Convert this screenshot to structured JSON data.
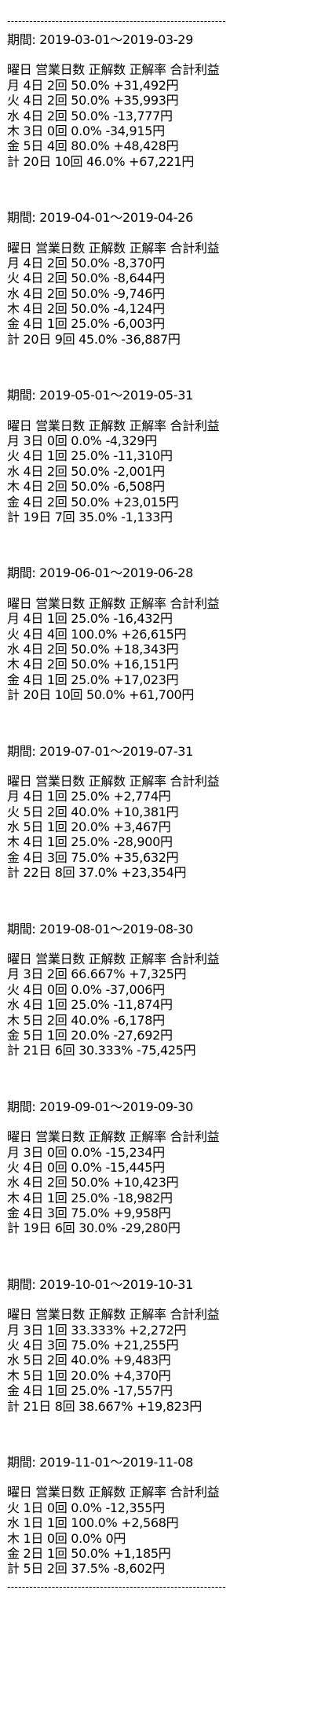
{
  "divider": "-----------------------------------------------------------",
  "period_label": "期間:",
  "header": "曜日 営業日数 正解数 正解率 合計利益",
  "blocks": [
    {
      "period": "2019-03-01〜2019-03-29",
      "rows": [
        "月 4日 2回 50.0% +31,492円",
        "火 4日 2回 50.0% +35,993円",
        "水 4日 2回 50.0% -13,777円",
        "木 3日 0回 0.0% -34,915円",
        "金 5日 4回 80.0% +48,428円",
        "計 20日 10回 46.0% +67,221円"
      ]
    },
    {
      "period": "2019-04-01〜2019-04-26",
      "rows": [
        "月 4日 2回 50.0% -8,370円",
        "火 4日 2回 50.0% -8,644円",
        "水 4日 2回 50.0% -9,746円",
        "木 4日 2回 50.0% -4,124円",
        "金 4日 1回 25.0% -6,003円",
        "計 20日 9回 45.0% -36,887円"
      ]
    },
    {
      "period": "2019-05-01〜2019-05-31",
      "rows": [
        "月 3日 0回 0.0% -4,329円",
        "火 4日 1回 25.0% -11,310円",
        "水 4日 2回 50.0% -2,001円",
        "木 4日 2回 50.0% -6,508円",
        "金 4日 2回 50.0% +23,015円",
        "計 19日 7回 35.0% -1,133円"
      ]
    },
    {
      "period": "2019-06-01〜2019-06-28",
      "rows": [
        "月 4日 1回 25.0% -16,432円",
        "火 4日 4回 100.0% +26,615円",
        "水 4日 2回 50.0% +18,343円",
        "木 4日 2回 50.0% +16,151円",
        "金 4日 1回 25.0% +17,023円",
        "計 20日 10回 50.0% +61,700円"
      ]
    },
    {
      "period": "2019-07-01〜2019-07-31",
      "rows": [
        "月 4日 1回 25.0% +2,774円",
        "火 5日 2回 40.0% +10,381円",
        "水 5日 1回 20.0% +3,467円",
        "木 4日 1回 25.0% -28,900円",
        "金 4日 3回 75.0% +35,632円",
        "計 22日 8回 37.0% +23,354円"
      ]
    },
    {
      "period": "2019-08-01〜2019-08-30",
      "rows": [
        "月 3日 2回 66.667% +7,325円",
        "火 4日 0回 0.0% -37,006円",
        "水 4日 1回 25.0% -11,874円",
        "木 5日 2回 40.0% -6,178円",
        "金 5日 1回 20.0% -27,692円",
        "計 21日 6回 30.333% -75,425円"
      ]
    },
    {
      "period": "2019-09-01〜2019-09-30",
      "rows": [
        "月 3日 0回 0.0% -15,234円",
        "火 4日 0回 0.0% -15,445円",
        "水 4日 2回 50.0% +10,423円",
        "木 4日 1回 25.0% -18,982円",
        "金 4日 3回 75.0% +9,958円",
        "計 19日 6回 30.0% -29,280円"
      ]
    },
    {
      "period": "2019-10-01〜2019-10-31",
      "rows": [
        "月 3日 1回 33.333% +2,272円",
        "火 4日 3回 75.0% +21,255円",
        "水 5日 2回 40.0% +9,483円",
        "木 5日 1回 20.0% +4,370円",
        "金 4日 1回 25.0% -17,557円",
        "計 21日 8回 38.667% +19,823円"
      ]
    },
    {
      "period": "2019-11-01〜2019-11-08",
      "rows": [
        "火 1日 0回 0.0% -12,355円",
        "水 1日 1回 100.0% +2,568円",
        "木 1日 0回 0.0% 0円",
        "金 2日 1回 50.0% +1,185円",
        "計 5日 2回 37.5% -8,602円"
      ]
    }
  ]
}
